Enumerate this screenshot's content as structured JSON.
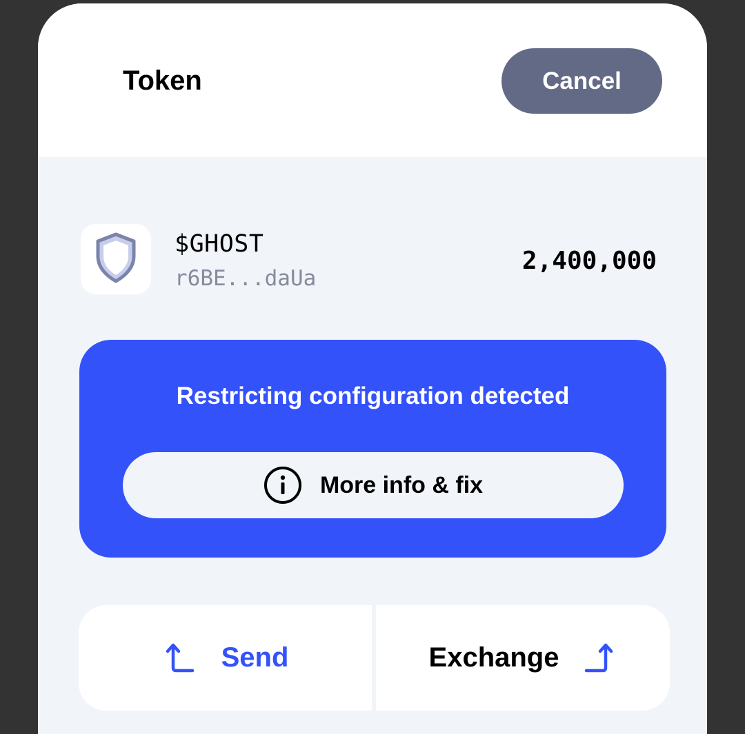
{
  "header": {
    "title": "Token",
    "cancel_label": "Cancel"
  },
  "token": {
    "name": "$GHOST",
    "address": "r6BE...daUa",
    "balance": "2,400,000",
    "icon": "shield-icon"
  },
  "alert": {
    "title": "Restricting configuration detected",
    "button_label": "More info & fix",
    "button_icon": "info-icon"
  },
  "actions": {
    "send_label": "Send",
    "send_icon": "arrow-up-left-icon",
    "exchange_label": "Exchange",
    "exchange_icon": "arrow-up-right-icon"
  },
  "colors": {
    "accent": "#3452fa",
    "cancel_bg": "#626a86",
    "panel_bg": "#f1f5f9",
    "backdrop": "#333333",
    "muted_text": "#868a9c"
  }
}
